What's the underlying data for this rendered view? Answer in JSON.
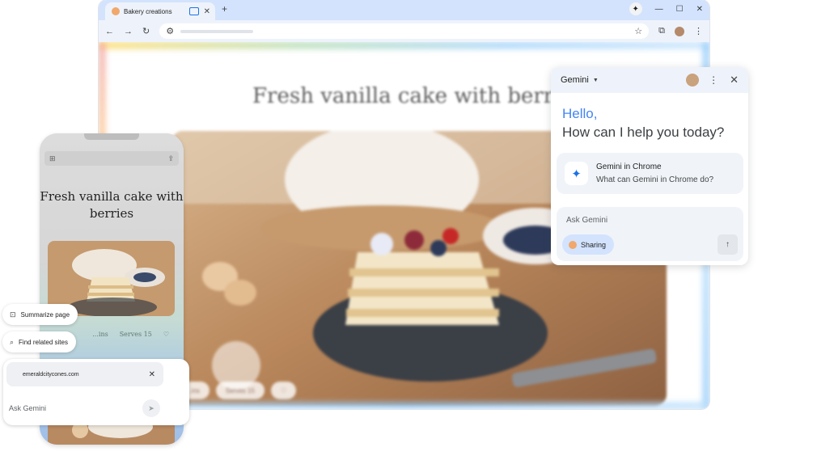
{
  "browser": {
    "tab_title": "Bakery creations",
    "new_tab_glyph": "+",
    "close_glyph": "✕",
    "win_spark": "✦",
    "win_minimize": "—",
    "win_maximize": "☐",
    "win_close": "✕",
    "nav": {
      "back": "←",
      "forward": "→",
      "reload": "↻",
      "tune": "⚙",
      "star": "☆",
      "extensions": "⧉",
      "menu": "⋮"
    }
  },
  "page": {
    "title": "Fresh vanilla cake with berries",
    "chip_1": "...ins",
    "chip_2": "Serves 15",
    "chip_3": "♡"
  },
  "gemini_panel": {
    "title": "Gemini",
    "caret": "▼",
    "more": "⋮",
    "close": "✕",
    "hello": "Hello,",
    "question": "How can I help you today?",
    "card_icon": "✦",
    "card_title": "Gemini in Chrome",
    "card_subtitle": "What can Gemini in Chrome do?",
    "input_placeholder": "Ask Gemini",
    "sharing_label": "Sharing",
    "send_icon": "↑"
  },
  "phone": {
    "title": "Fresh vanilla cake with berries",
    "meta_left": "...ins",
    "meta_serves": "Serves 15",
    "meta_heart": "♡",
    "pill_summarize": "Summarize page",
    "pill_related": "Find related sites",
    "site_chip": "emeraldcitycones.com",
    "site_chip_close": "✕",
    "input_placeholder": "Ask Gemini",
    "send_icon": "➤",
    "bar_left": "⊞",
    "bar_right": "⇪"
  },
  "colors": {
    "accent_blue": "#1a73e8",
    "gemini_blue": "#4285f4",
    "tab_strip": "#d3e3fd"
  }
}
